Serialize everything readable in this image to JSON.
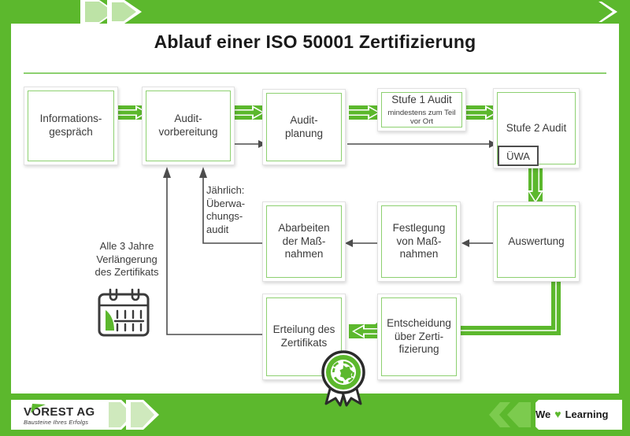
{
  "header": {
    "title": "Ablauf einer ISO 50001 Zertifizierung"
  },
  "nodes": {
    "informationsgespraech": {
      "label": "Informations-\ngespräch"
    },
    "auditvorbereitung": {
      "label": "Audit-\nvorbereitung"
    },
    "auditplanung": {
      "label": "Audit-\nplanung"
    },
    "stufe1": {
      "label": "Stufe 1 Audit",
      "sub": "mindestens zum Teil\nvor Ort"
    },
    "stufe2": {
      "label": "Stufe 2 Audit",
      "badge": "ÜWA"
    },
    "auswertung": {
      "label": "Auswertung"
    },
    "festlegung": {
      "label": "Festlegung\nvon Maß-\nnahmen"
    },
    "abarbeiten": {
      "label": "Abarbeiten\nder Maß-\nnahmen"
    },
    "entscheidung": {
      "label": "Entscheidung\nüber Zerti-\nfizierung"
    },
    "erteilung": {
      "label": "Erteilung des\nZertifikats"
    }
  },
  "annotations": {
    "jaehrlich": "Jährlich:\nÜberwa-\nchungs-\naudit",
    "alle3jahre": "Alle 3 Jahre\nVerlängerung\ndes Zertifikats"
  },
  "icons": {
    "calendar": "calendar-icon",
    "seal": "certificate-seal-icon",
    "heart": "♥"
  },
  "footer": {
    "brand": "VOREST AG",
    "tagline": "Bausteine Ihres Erfolgs",
    "slogan_pre": "We",
    "slogan_post": "Learning"
  },
  "colors": {
    "green": "#5cb82d",
    "green_light": "#8dd070",
    "text": "#3b3b3b",
    "arrow_grey": "#4d4d4d"
  }
}
